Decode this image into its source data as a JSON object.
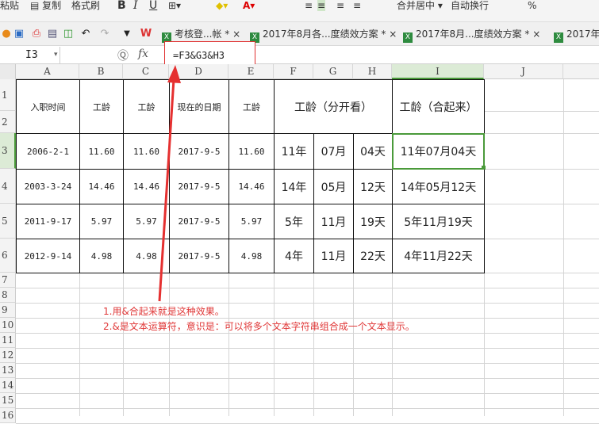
{
  "ribbon": {
    "paste": "粘贴",
    "copy": "复制",
    "format_painter": "格式刷",
    "bold": "B",
    "italic": "I",
    "underline": "U",
    "merge_center": "合并居中",
    "wrap_text": "自动换行",
    "percent": "%"
  },
  "tabs": [
    {
      "label": "考核登...帐 *"
    },
    {
      "label": "2017年8月各...度绩效方案 *"
    },
    {
      "label": "2017年8月...度绩效方案 *"
    },
    {
      "label": "2017年"
    }
  ],
  "formula_bar": {
    "cell_ref": "I3",
    "fx": "fx",
    "formula": "=F3&G3&H3"
  },
  "columns": [
    "A",
    "B",
    "C",
    "D",
    "E",
    "F",
    "G",
    "H",
    "I",
    "J"
  ],
  "rows": [
    "1",
    "2",
    "3",
    "4",
    "5",
    "6",
    "7",
    "8",
    "9",
    "10",
    "11",
    "12",
    "13",
    "14",
    "15",
    "16"
  ],
  "headers": {
    "a": "入职时间",
    "b": "工龄",
    "c": "工龄",
    "d": "现在的日期",
    "e": "工龄",
    "fgh": "工龄（分开看）",
    "i": "工龄（合起来）"
  },
  "data": [
    [
      "2006-2-1",
      "11.60",
      "11.60",
      "2017-9-5",
      "11.60",
      "11年",
      "07月",
      "04天",
      "11年07月04天"
    ],
    [
      "2003-3-24",
      "14.46",
      "14.46",
      "2017-9-5",
      "14.46",
      "14年",
      "05月",
      "12天",
      "14年05月12天"
    ],
    [
      "2011-9-17",
      "5.97",
      "5.97",
      "2017-9-5",
      "5.97",
      "5年",
      "11月",
      "19天",
      "5年11月19天"
    ],
    [
      "2012-9-14",
      "4.98",
      "4.98",
      "2017-9-5",
      "4.98",
      "4年",
      "11月",
      "22天",
      "4年11月22天"
    ]
  ],
  "annotation": {
    "line1": "1.用&合起来就是这种效果。",
    "line2": "2.&是文本运算符，意识是：可以将多个文本字符串组合成一个文本显示。"
  },
  "colors": {
    "accent": "#4a9a3a",
    "annotation": "#e03838"
  }
}
